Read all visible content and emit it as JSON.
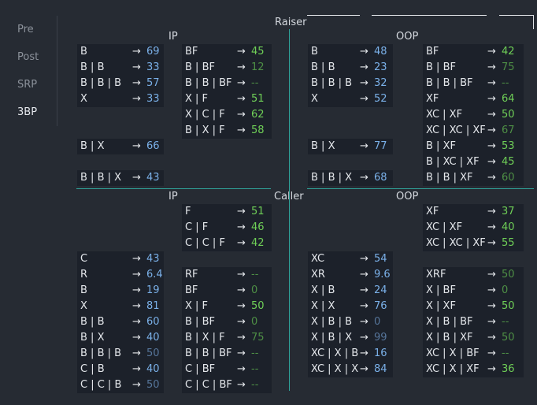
{
  "sidebar": {
    "items": [
      {
        "label": "Pre",
        "active": false
      },
      {
        "label": "Post",
        "active": false
      },
      {
        "label": "SRP",
        "active": false
      },
      {
        "label": "3BP",
        "active": true
      }
    ]
  },
  "sections": {
    "raiser": "Raiser",
    "caller": "Caller",
    "ip": "IP",
    "oop": "OOP"
  },
  "arrow": "→",
  "colors": {
    "background": "#262b33",
    "panel": "#1c212a",
    "divider": "#2fa39a",
    "blue_value": "#7ab0e8",
    "green_value": "#6fcf57",
    "dim_green_value": "#4e8f45",
    "dim_blue_value": "#56759a"
  },
  "panels": {
    "raiser_ip_bet": [
      {
        "label": "B",
        "value": "69",
        "tone": "blue"
      },
      {
        "label": "B | B",
        "value": "33",
        "tone": "blue"
      },
      {
        "label": "B | B | B",
        "value": "57",
        "tone": "blue"
      },
      {
        "label": "X",
        "value": "33",
        "tone": "blue"
      }
    ],
    "raiser_ip_bx": [
      {
        "label": "B | X",
        "value": "66",
        "tone": "blue"
      }
    ],
    "raiser_ip_bbx": [
      {
        "label": "B | B | X",
        "value": "43",
        "tone": "blue"
      }
    ],
    "raiser_ip_fold": [
      {
        "label": "BF",
        "value": "45",
        "tone": "green"
      },
      {
        "label": "B | BF",
        "value": "12",
        "tone": "dgreen"
      },
      {
        "label": "B | B | BF",
        "value": "--",
        "tone": "dash"
      },
      {
        "label": "X | F",
        "value": "51",
        "tone": "green"
      },
      {
        "label": "X | C | F",
        "value": "62",
        "tone": "green"
      },
      {
        "label": "B | X | F",
        "value": "58",
        "tone": "green"
      }
    ],
    "raiser_oop_bet": [
      {
        "label": "B",
        "value": "48",
        "tone": "blue"
      },
      {
        "label": "B | B",
        "value": "23",
        "tone": "blue"
      },
      {
        "label": "B | B | B",
        "value": "32",
        "tone": "blue"
      },
      {
        "label": "X",
        "value": "52",
        "tone": "blue"
      }
    ],
    "raiser_oop_bx": [
      {
        "label": "B | X",
        "value": "77",
        "tone": "blue"
      }
    ],
    "raiser_oop_bbx": [
      {
        "label": "B | B | X",
        "value": "68",
        "tone": "blue"
      }
    ],
    "raiser_oop_fold": [
      {
        "label": "BF",
        "value": "42",
        "tone": "green"
      },
      {
        "label": "B | BF",
        "value": "75",
        "tone": "dgreen"
      },
      {
        "label": "B | B | BF",
        "value": "--",
        "tone": "dash"
      },
      {
        "label": "XF",
        "value": "64",
        "tone": "green"
      },
      {
        "label": "XC | XF",
        "value": "50",
        "tone": "green"
      },
      {
        "label": "XC | XC | XF",
        "value": "67",
        "tone": "dgreen"
      },
      {
        "label": "B | XF",
        "value": "53",
        "tone": "green"
      },
      {
        "label": "B | XC | XF",
        "value": "45",
        "tone": "green"
      },
      {
        "label": "B | B | XF",
        "value": "60",
        "tone": "dgreen"
      }
    ],
    "caller_ip_top": [
      {
        "label": "F",
        "value": "51",
        "tone": "green"
      },
      {
        "label": "C | F",
        "value": "46",
        "tone": "green"
      },
      {
        "label": "C | C | F",
        "value": "42",
        "tone": "green"
      }
    ],
    "caller_ip_left": [
      {
        "label": "C",
        "value": "43",
        "tone": "blue"
      },
      {
        "label": "R",
        "value": "6.4",
        "tone": "blue"
      },
      {
        "label": "B",
        "value": "19",
        "tone": "blue"
      },
      {
        "label": "X",
        "value": "81",
        "tone": "blue"
      },
      {
        "label": "B | B",
        "value": "60",
        "tone": "blue"
      },
      {
        "label": "B | X",
        "value": "40",
        "tone": "blue"
      },
      {
        "label": "B | B | B",
        "value": "50",
        "tone": "dblue"
      },
      {
        "label": "C | B",
        "value": "40",
        "tone": "blue"
      },
      {
        "label": "C | C | B",
        "value": "50",
        "tone": "dblue"
      }
    ],
    "caller_ip_right": [
      {
        "label": "RF",
        "value": "--",
        "tone": "dash"
      },
      {
        "label": "BF",
        "value": "0",
        "tone": "dgreen"
      },
      {
        "label": "X | F",
        "value": "50",
        "tone": "green"
      },
      {
        "label": "B | BF",
        "value": "0",
        "tone": "dgreen"
      },
      {
        "label": "B | X | F",
        "value": "75",
        "tone": "dgreen"
      },
      {
        "label": "B | B | BF",
        "value": "--",
        "tone": "dash"
      },
      {
        "label": "C | BF",
        "value": "--",
        "tone": "dash"
      },
      {
        "label": "C | C | BF",
        "value": "--",
        "tone": "dash"
      }
    ],
    "caller_oop_top": [
      {
        "label": "XF",
        "value": "37",
        "tone": "green"
      },
      {
        "label": "XC | XF",
        "value": "40",
        "tone": "green"
      },
      {
        "label": "XC | XC | XF",
        "value": "55",
        "tone": "green"
      }
    ],
    "caller_oop_left": [
      {
        "label": "XC",
        "value": "54",
        "tone": "blue"
      },
      {
        "label": "XR",
        "value": "9.6",
        "tone": "blue"
      },
      {
        "label": "X | B",
        "value": "24",
        "tone": "blue"
      },
      {
        "label": "X | X",
        "value": "76",
        "tone": "blue"
      },
      {
        "label": "X | B | B",
        "value": "0",
        "tone": "dblue"
      },
      {
        "label": "X | B | X",
        "value": "99",
        "tone": "dblue"
      },
      {
        "label": "XC | X | B",
        "value": "16",
        "tone": "blue"
      },
      {
        "label": "XC | X | X",
        "value": "84",
        "tone": "blue"
      }
    ],
    "caller_oop_right": [
      {
        "label": "XRF",
        "value": "50",
        "tone": "dgreen"
      },
      {
        "label": "X | BF",
        "value": "0",
        "tone": "dgreen"
      },
      {
        "label": "X | XF",
        "value": "50",
        "tone": "green"
      },
      {
        "label": "X | B | BF",
        "value": "--",
        "tone": "dash"
      },
      {
        "label": "X | B | XF",
        "value": "50",
        "tone": "dgreen"
      },
      {
        "label": "XC | X | BF",
        "value": "--",
        "tone": "dash"
      },
      {
        "label": "XC | X | XF",
        "value": "36",
        "tone": "green"
      }
    ]
  }
}
